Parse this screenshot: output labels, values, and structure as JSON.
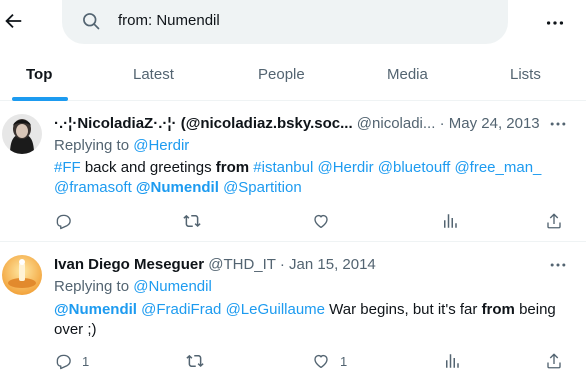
{
  "search": {
    "value": "from: Numendil"
  },
  "tabs": [
    {
      "label": "Top"
    },
    {
      "label": "Latest"
    },
    {
      "label": "People"
    },
    {
      "label": "Media"
    },
    {
      "label": "Lists"
    }
  ],
  "tweets": [
    {
      "display_name": "·.·¦·NicoladiaZ·.·¦· (@nicoladiaz.bsky.soc...",
      "handle": "@nicoladi...",
      "sep": "·",
      "date": "May 24, 2013",
      "replying_label": "Replying to",
      "replying_to": "@Herdir",
      "body": {
        "t1": "#FF",
        "t2": " back and greetings ",
        "t3": "from",
        "t4": "#istanbul",
        "t5": "@Herdir",
        "t6": "@bluetouff",
        "t7": "@free_man_",
        "t8": "@framasoft",
        "t9": "@Numendil",
        "t10": "@Spartition"
      },
      "counts": {
        "reply": "",
        "retweet": "",
        "like": "",
        "views": ""
      }
    },
    {
      "display_name": "Ivan Diego Meseguer",
      "handle": "@THD_IT",
      "sep": "·",
      "date": "Jan 15, 2014",
      "replying_label": "Replying to",
      "replying_to": "@Numendil",
      "body": {
        "t1": "@Numendil",
        "t2": "@FradiFrad",
        "t3": "@LeGuillaume",
        "t4": " War begins, but it's far ",
        "t5": "from",
        "t6": " being over ;)"
      },
      "counts": {
        "reply": "1",
        "retweet": "",
        "like": "1",
        "views": ""
      }
    }
  ],
  "colors": {
    "accent": "#1d9bf0",
    "muted": "#536471",
    "text": "#0f1419",
    "search_bg": "#eff3f4"
  }
}
